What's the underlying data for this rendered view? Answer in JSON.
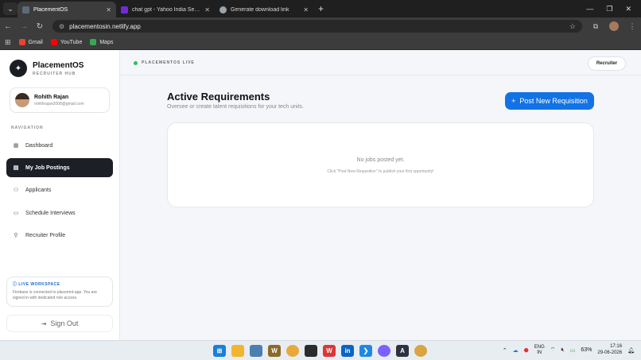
{
  "browser": {
    "tabs": [
      {
        "title": "PlacementOS",
        "active": true,
        "favicon_color": "#5b6b7a"
      },
      {
        "title": "chat gpt - Yahoo India Search R",
        "active": false,
        "favicon_color": "#6f2bd6"
      },
      {
        "title": "Generate download link",
        "active": false,
        "favicon_color": "#9aa4ad"
      }
    ],
    "url": "placementosin.netlify.app",
    "bookmarks": [
      {
        "label": "Gmail",
        "color": "#ea4335"
      },
      {
        "label": "YouTube",
        "color": "#ff0000"
      },
      {
        "label": "Maps",
        "color": "#34a853"
      }
    ]
  },
  "sidebar": {
    "brand_title": "PlacementOS",
    "brand_subtitle": "RECRUITER HUB",
    "user_name": "Rohith Rajan",
    "user_email": "rohithrajan2008@gmail.com",
    "nav_heading": "NAVIGATION",
    "nav_items": [
      {
        "label": "Dashboard",
        "icon": "grid-icon",
        "active": false
      },
      {
        "label": "My Job Postings",
        "icon": "briefcase-icon",
        "active": true
      },
      {
        "label": "Applicants",
        "icon": "users-icon",
        "active": false
      },
      {
        "label": "Schedule Interviews",
        "icon": "calendar-icon",
        "active": false
      },
      {
        "label": "Recruiter Profile",
        "icon": "user-icon",
        "active": false
      }
    ],
    "workspace_title": "LIVE WORKSPACE",
    "workspace_text": "Firebase is connected to placemnt-app. You are signed in with dedicated role access.",
    "signout_label": "Sign Out"
  },
  "topbar": {
    "status_label": "PLACEMENTOS LIVE",
    "status_color": "#22c55e",
    "role_label": "Recruiter"
  },
  "main": {
    "title": "Active Requirements",
    "subtitle": "Oversee or create talent requisitions for your tech units.",
    "post_button_label": "Post New Requisition",
    "accent_color": "#1272e6",
    "empty_title": "No jobs posted yet.",
    "empty_hint": "Click \"Post New Requisition\" to publish your first opportunity!"
  },
  "taskbar": {
    "language": "ENG",
    "region": "IN",
    "battery": "63%",
    "time": "17:16",
    "date": "29-06-2026"
  }
}
